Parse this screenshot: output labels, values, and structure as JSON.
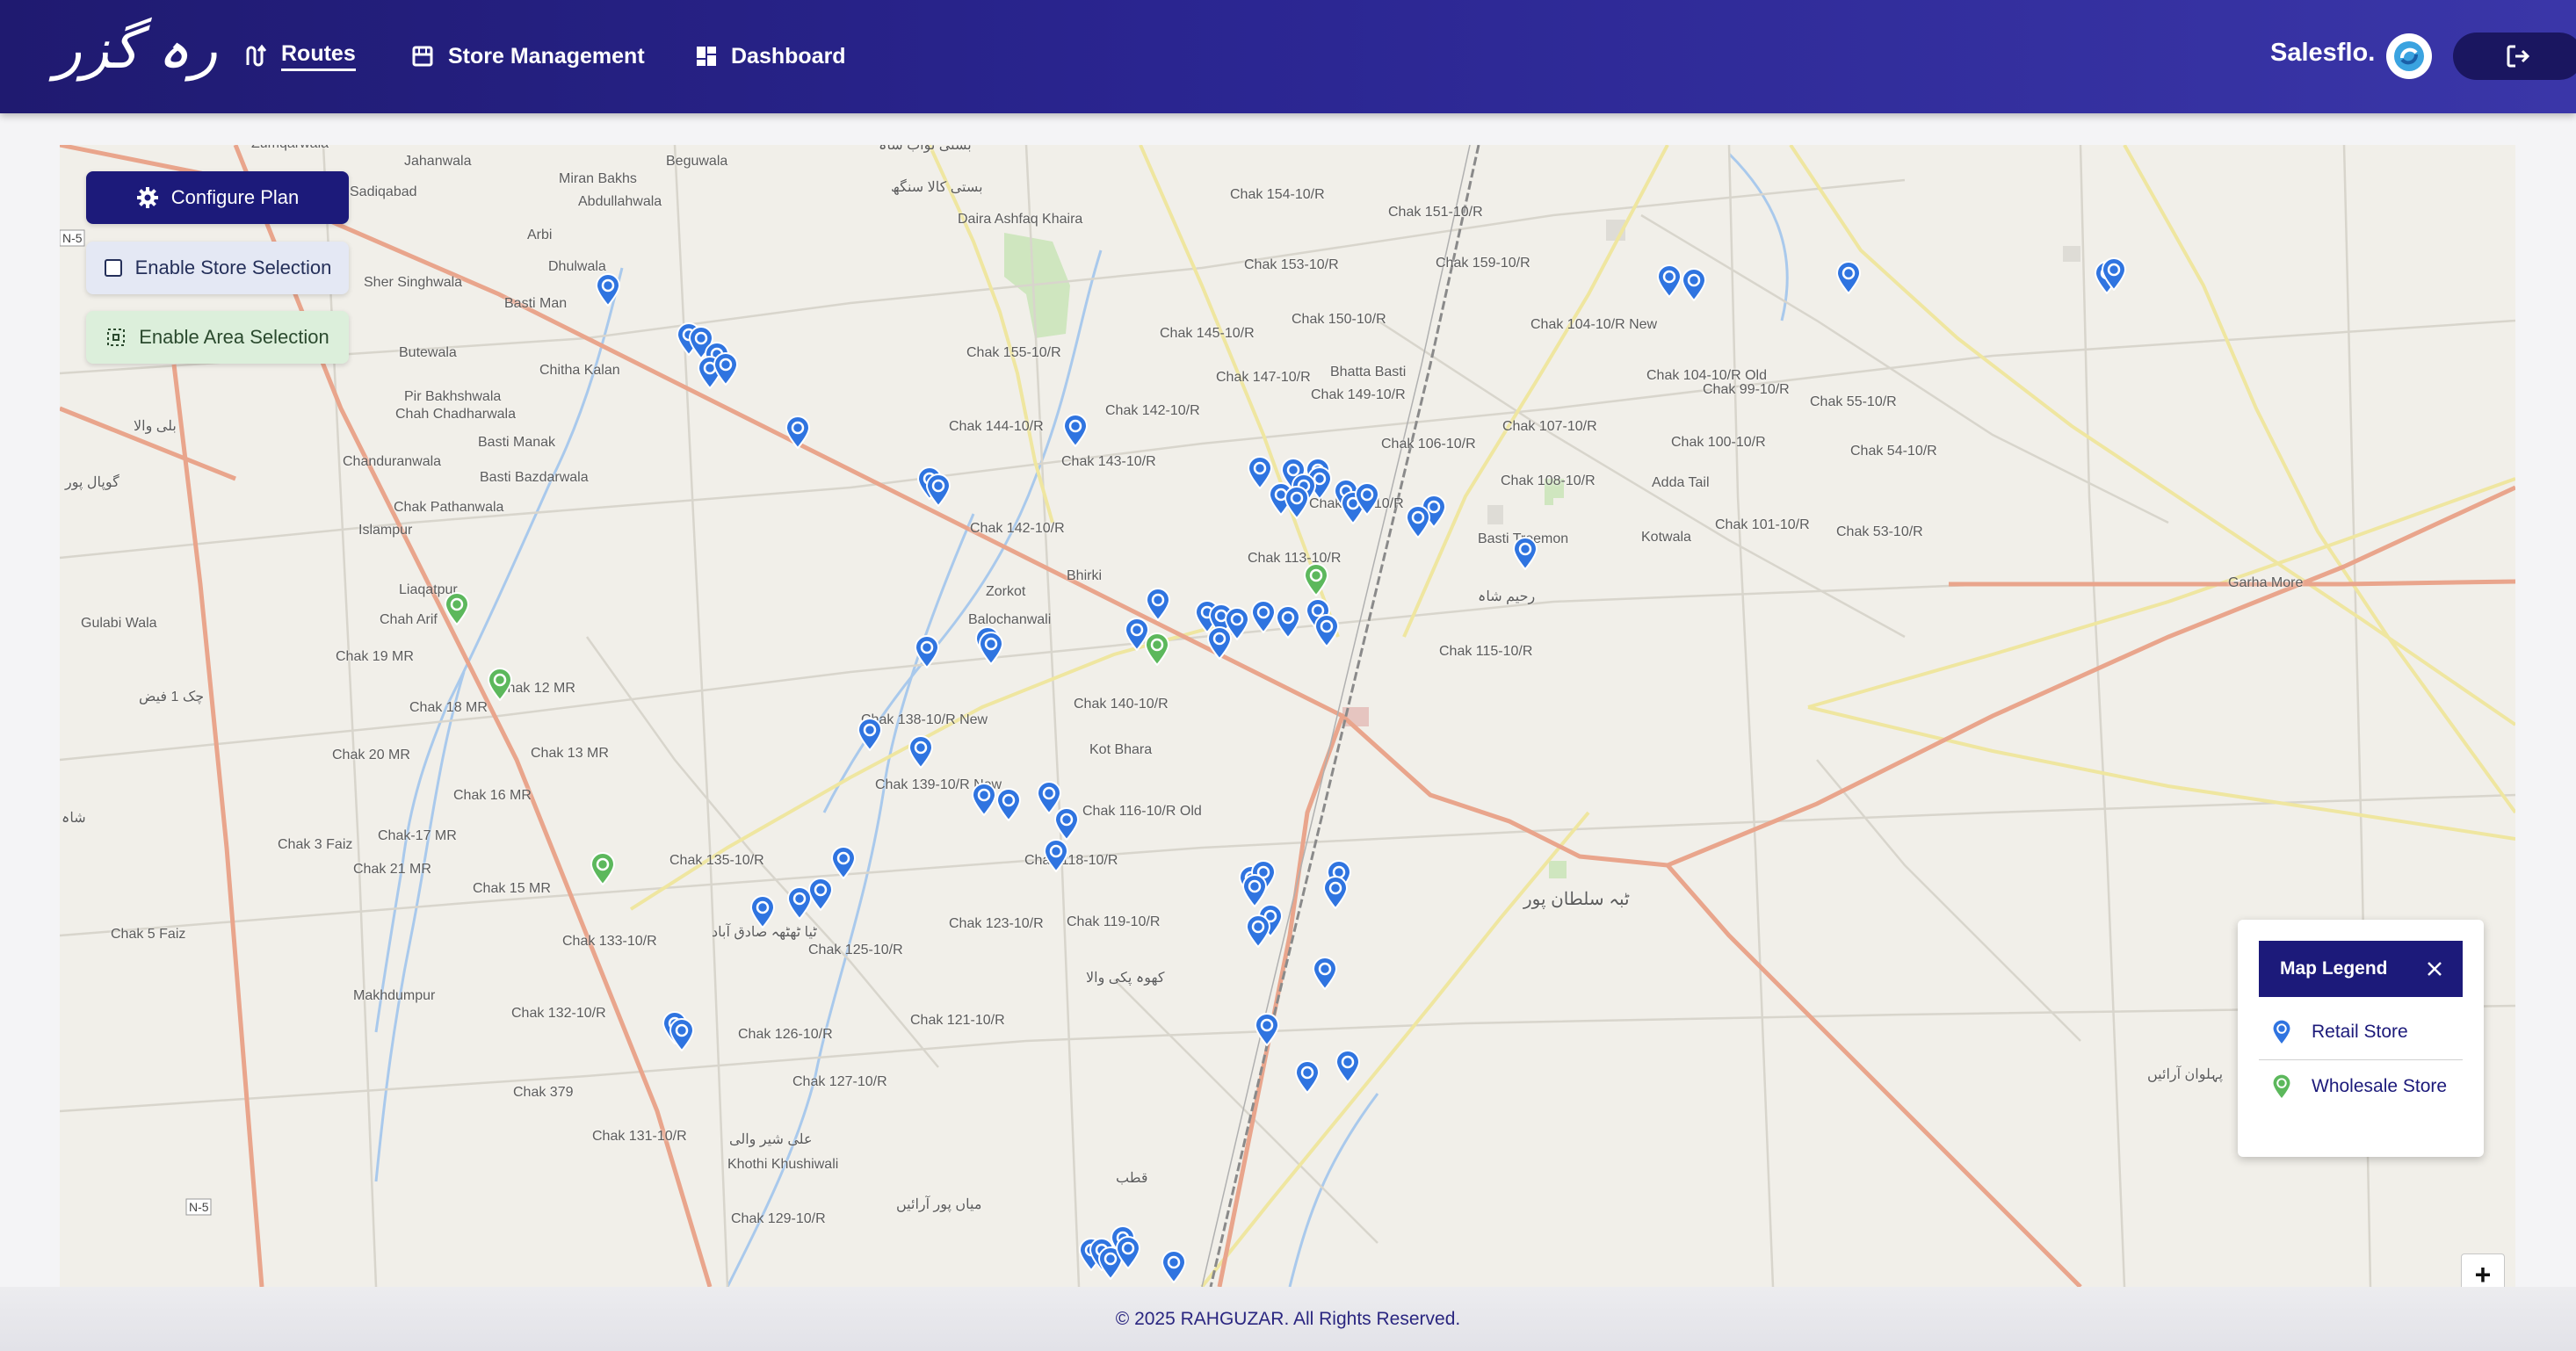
{
  "app": {
    "logo_text": "رہ گزر"
  },
  "nav": [
    {
      "label": "Routes",
      "icon": "route-icon",
      "active": true
    },
    {
      "label": "Store Management",
      "icon": "store-icon",
      "active": false
    },
    {
      "label": "Dashboard",
      "icon": "dashboard-icon",
      "active": false
    }
  ],
  "brand": {
    "label": "Salesflo."
  },
  "controls": {
    "configure_plan": "Configure Plan",
    "enable_store_selection": "Enable Store Selection",
    "enable_area_selection": "Enable Area Selection"
  },
  "legend": {
    "title": "Map Legend",
    "items": [
      {
        "label": "Retail Store",
        "color": "#2f74e0"
      },
      {
        "label": "Wholesale Store",
        "color": "#5cb85c"
      }
    ]
  },
  "zoom": {
    "in_label": "+"
  },
  "footer": {
    "text": "© 2025 RAHGUZAR. All Rights Reserved."
  },
  "colors": {
    "header": "#231e80",
    "retail": "#2f74e0",
    "wholesale": "#5cb85c",
    "primary_button": "#1c1a7a"
  },
  "map_labels": [
    "Zumqarwala",
    "Jahanwala",
    "Sadiqabad",
    "Beguwala",
    "Miran Bakhs",
    "Abdullahwala",
    "Arbi",
    "Dhulwala",
    "Sher Singhwala",
    "Basti Man",
    "Butewala",
    "Chitha Kalan",
    "Pir Bakhshwala",
    "Chah Chadharwala",
    "Basti Manak",
    "Basti Bazdarwala",
    "Chanduranwala",
    "Chak Pathanwala",
    "Islampur",
    "Liaqatpur",
    "Chah Arif",
    "Gulabi Wala",
    "Chak 19 MR",
    "Chak 18 MR",
    "Chak 12 MR",
    "Chak 20 MR",
    "Chak 13 MR",
    "Chak 16 MR",
    "Chak 3 Faiz",
    "Chak-17 MR",
    "Chak 21 MR",
    "Chak 15 MR",
    "Chak 5 Faiz",
    "Makhdumpur",
    "Chak 132-10/R",
    "Chak 379",
    "Chak 131-10/R",
    "Khothi Khushiwali",
    "Chak 129-10/R",
    "Chak 126-10/R",
    "Chak 127-10/R",
    "Chak 121-10/R",
    "Chak 125-10/R",
    "Chak 133-10/R",
    "Chak 135-10/R",
    "Chak 123-10/R",
    "Chak 119-10/R",
    "Chak 118-10/R",
    "Chak 116-10/R Old",
    "Chak 139-10/R New",
    "Chak 138-10/R New",
    "Chak 140-10/R",
    "Kot Bhara",
    "Zorkot",
    "Balochanwali",
    "Bhirki",
    "Chak 142-10/R",
    "Chak 143-10/R",
    "Chak 144-10/R",
    "Chak 155-10/R",
    "Daira Ashfaq Khaira",
    "Chak 145-10/R",
    "Chak 142-10/R",
    "Chak 147-10/R",
    "Chak 149-10/R",
    "Bhatta Basti",
    "Chak 150-10/R",
    "Chak 153-10/R",
    "Chak 154-10/R",
    "Chak 151-10/R",
    "Chak 159-10/R",
    "Chak 106-10/R",
    "Chak 109-10/R",
    "Chak 113-10/R",
    "Basti Treemon",
    "Chak 108-10/R",
    "Chak 107-10/R",
    "Chak 104-10/R New",
    "Chak 104-10/R Old",
    "Chak 100-10/R",
    "Adda Tail",
    "Kotwala",
    "Chak 99-10/R",
    "Chak 101-10/R",
    "Chak 55-10/R",
    "Chak 54-10/R",
    "Chak 53-10/R",
    "Chak 115-10/R",
    "Garha More",
    "N-5",
    "N-5"
  ],
  "map_labels_urdu": [
    "بستی نواب شاہ",
    "بستی کالا سنگھ",
    "بلی والا",
    "گوپال پور",
    "چک 1 فیض",
    "شاہ",
    "ٹبہ سلطان پور",
    "پہلوان آرائیں",
    "کھوہ پکی والا",
    "میاں پور آرائیں",
    "علی شیر والی",
    "ٹیا ٹھٹھہ صادق آباد",
    "رحیم شاہ",
    "قطب"
  ]
}
